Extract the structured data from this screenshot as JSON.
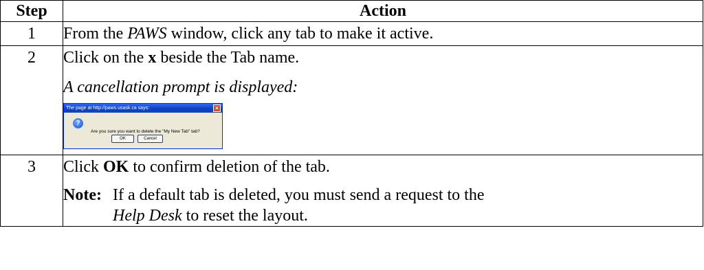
{
  "table": {
    "headers": {
      "step": "Step",
      "action": "Action"
    },
    "rows": [
      {
        "step": "1",
        "action_parts": [
          "From the ",
          "PAWS",
          " window, click any tab to make it active."
        ]
      },
      {
        "step": "2",
        "action_parts": [
          "Click on the ",
          "x",
          " beside the Tab name."
        ],
        "prompt_text": "A cancellation prompt is displayed:",
        "dialog": {
          "title": "The page at http://paws.usask.ca says:",
          "message": "Are you sure you want to delete the \"My New Tab\" tab?",
          "ok_label": "OK",
          "cancel_label": "Cancel",
          "icon": "question-icon",
          "close_icon": "close-icon"
        }
      },
      {
        "step": "3",
        "action_parts": [
          "Click ",
          "OK",
          " to confirm deletion of the tab."
        ],
        "note_label": "Note:",
        "note_lines": [
          {
            "parts": [
              "If a default tab is deleted, you must send a request to the"
            ]
          },
          {
            "parts": [
              "Help Desk",
              " to reset the layout."
            ]
          }
        ]
      }
    ]
  }
}
